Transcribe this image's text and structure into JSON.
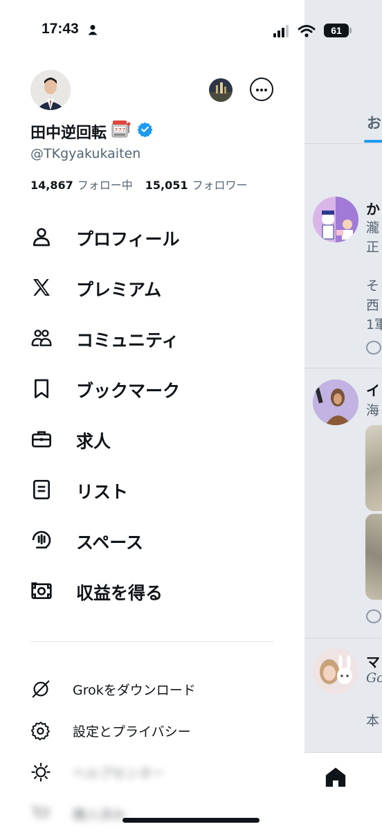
{
  "status_bar": {
    "time": "17:43",
    "battery": "61"
  },
  "profile": {
    "display_name": "田中逆回転",
    "handle": "@TKgyakukaiten",
    "following_count": "14,867",
    "following_label": "フォロー中",
    "followers_count": "15,051",
    "followers_label": "フォロワー"
  },
  "menu": [
    {
      "label": "プロフィール",
      "icon": "person-icon"
    },
    {
      "label": "プレミアム",
      "icon": "x-logo-icon"
    },
    {
      "label": "コミュニティ",
      "icon": "communities-icon"
    },
    {
      "label": "ブックマーク",
      "icon": "bookmark-icon"
    },
    {
      "label": "求人",
      "icon": "briefcase-icon"
    },
    {
      "label": "リスト",
      "icon": "list-icon"
    },
    {
      "label": "スペース",
      "icon": "spaces-icon"
    },
    {
      "label": "収益を得る",
      "icon": "money-icon"
    }
  ],
  "secondary": [
    {
      "label": "Grokをダウンロード",
      "icon": "grok-icon"
    },
    {
      "label": "設定とプライバシー",
      "icon": "gear-icon"
    },
    {
      "label": "ヘルプセンター",
      "icon": "lightbulb-icon"
    },
    {
      "label": "購入済み",
      "icon": "cart-icon"
    }
  ],
  "timeline": {
    "tab_label": "お",
    "posts": [
      {
        "name": "か",
        "lines": [
          "瀧",
          "正",
          "",
          "そ",
          "西",
          "1軍"
        ]
      },
      {
        "name": "イ",
        "lines": [
          "海"
        ]
      },
      {
        "name": "マ",
        "lines": [
          "Go",
          "",
          "本"
        ]
      }
    ]
  },
  "colors": {
    "accent": "#1d9bf0",
    "text": "#0f1419",
    "secondary_text": "#536471"
  }
}
